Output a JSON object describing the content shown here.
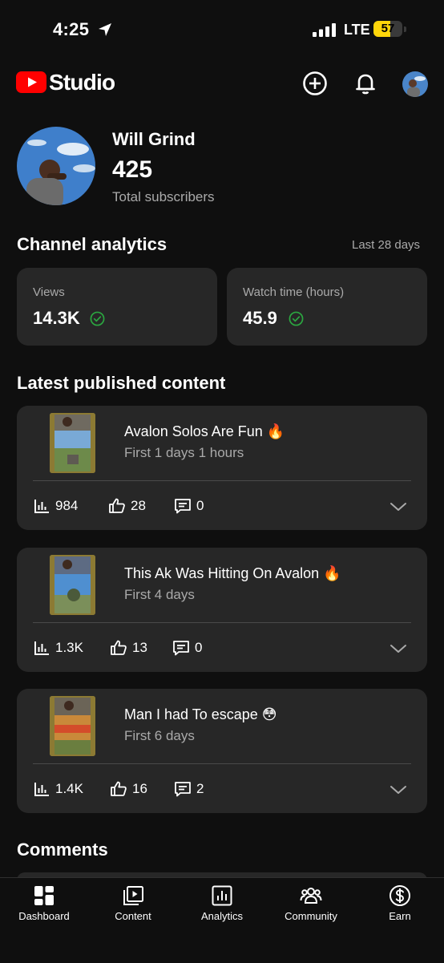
{
  "status_bar": {
    "time": "4:25",
    "network": "LTE",
    "battery_level": 57,
    "battery_label": "57"
  },
  "header": {
    "app_name": "Studio"
  },
  "channel": {
    "name": "Will Grind",
    "subscriber_count": "425",
    "subscriber_label": "Total subscribers"
  },
  "analytics": {
    "title": "Channel analytics",
    "period": "Last 28 days",
    "metrics": [
      {
        "label": "Views",
        "value": "14.3K"
      },
      {
        "label": "Watch time (hours)",
        "value": "45.9"
      }
    ]
  },
  "latest": {
    "title": "Latest published content",
    "videos": [
      {
        "title": "Avalon Solos Are Fun 🔥",
        "subtitle": "First 1 days 1 hours",
        "views": "984",
        "likes": "28",
        "comments": "0"
      },
      {
        "title": "This Ak Was Hitting On Avalon 🔥",
        "subtitle": "First 4 days",
        "views": "1.3K",
        "likes": "13",
        "comments": "0"
      },
      {
        "title": "Man I had To escape 😳",
        "subtitle": "First 6 days",
        "views": "1.4K",
        "likes": "16",
        "comments": "2"
      }
    ]
  },
  "comments": {
    "title": "Comments"
  },
  "bottom_nav": {
    "items": [
      {
        "label": "Dashboard",
        "icon": "dashboard-icon"
      },
      {
        "label": "Content",
        "icon": "content-icon"
      },
      {
        "label": "Analytics",
        "icon": "analytics-icon"
      },
      {
        "label": "Community",
        "icon": "community-icon"
      },
      {
        "label": "Earn",
        "icon": "earn-icon"
      }
    ]
  },
  "colors": {
    "background": "#0f0f0f",
    "card": "#272727",
    "youtube_red": "#ff0000",
    "success_green": "#2ba640",
    "battery_yellow": "#ffd60a",
    "secondary_text": "#aaaaaa"
  }
}
